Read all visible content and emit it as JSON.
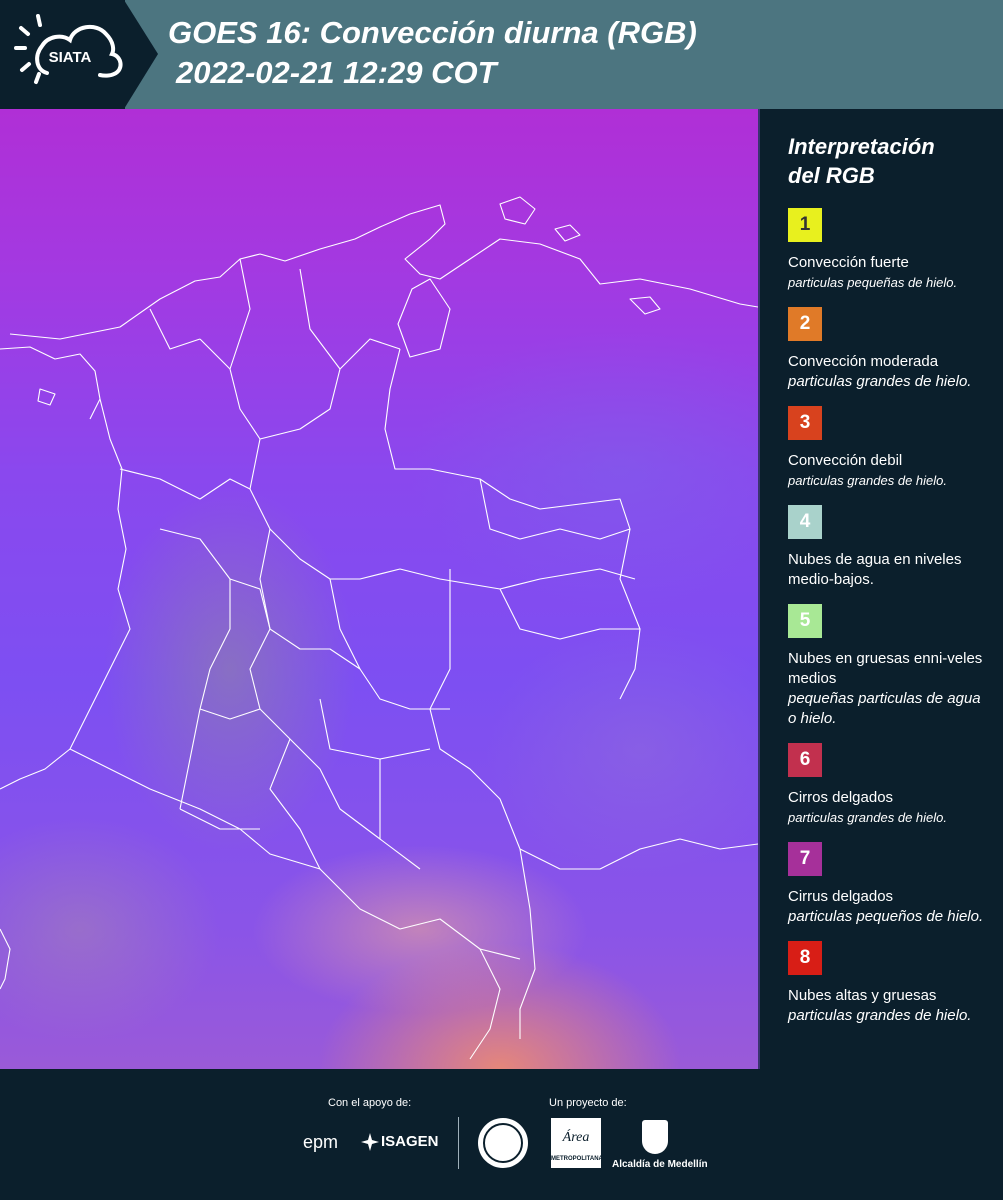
{
  "header": {
    "logo_text": "SIATA",
    "title": "GOES 16: Convección diurna (RGB)",
    "subtitle": "2022-02-21 12:29 COT"
  },
  "legend": {
    "title_line1": "Interpretación",
    "title_line2": "del RGB",
    "items": [
      {
        "number": "1",
        "color": "#e8f01e",
        "text_color": "#333333",
        "label": "Convección fuerte",
        "desc": "particulas pequeñas de hielo."
      },
      {
        "number": "2",
        "color": "#e07a28",
        "text_color": "#ffffff",
        "label": "Convección moderada",
        "desc": "particulas grandes de hielo."
      },
      {
        "number": "3",
        "color": "#d8421e",
        "text_color": "#ffffff",
        "label": "Convección debil",
        "desc": "particulas grandes de hielo."
      },
      {
        "number": "4",
        "color": "#a9d2cb",
        "text_color": "#ffffff",
        "label": "Nubes de agua en niveles medio-bajos.",
        "desc": ""
      },
      {
        "number": "5",
        "color": "#a8e895",
        "text_color": "#ffffff",
        "label": "Nubes en gruesas enni-veles medios",
        "desc": "pequeñas particulas de agua o hielo."
      },
      {
        "number": "6",
        "color": "#c2304e",
        "text_color": "#ffffff",
        "label": "Cirros delgados",
        "desc": "particulas grandes de hielo."
      },
      {
        "number": "7",
        "color": "#a6309a",
        "text_color": "#ffffff",
        "label": "Cirrus delgados",
        "desc": "particulas pequeños de hielo."
      },
      {
        "number": "8",
        "color": "#d81e16",
        "text_color": "#ffffff",
        "label": "Nubes altas y gruesas",
        "desc": "particulas grandes de hielo."
      }
    ]
  },
  "footer": {
    "support_label": "Con el apoyo de:",
    "project_label": "Un proyecto de:",
    "sponsor1": "epm",
    "sponsor2": "ISAGEN",
    "metro_brand": "Área",
    "metro_name": "METROPOLITANA",
    "alcaldia": "Alcaldía de Medellín"
  }
}
